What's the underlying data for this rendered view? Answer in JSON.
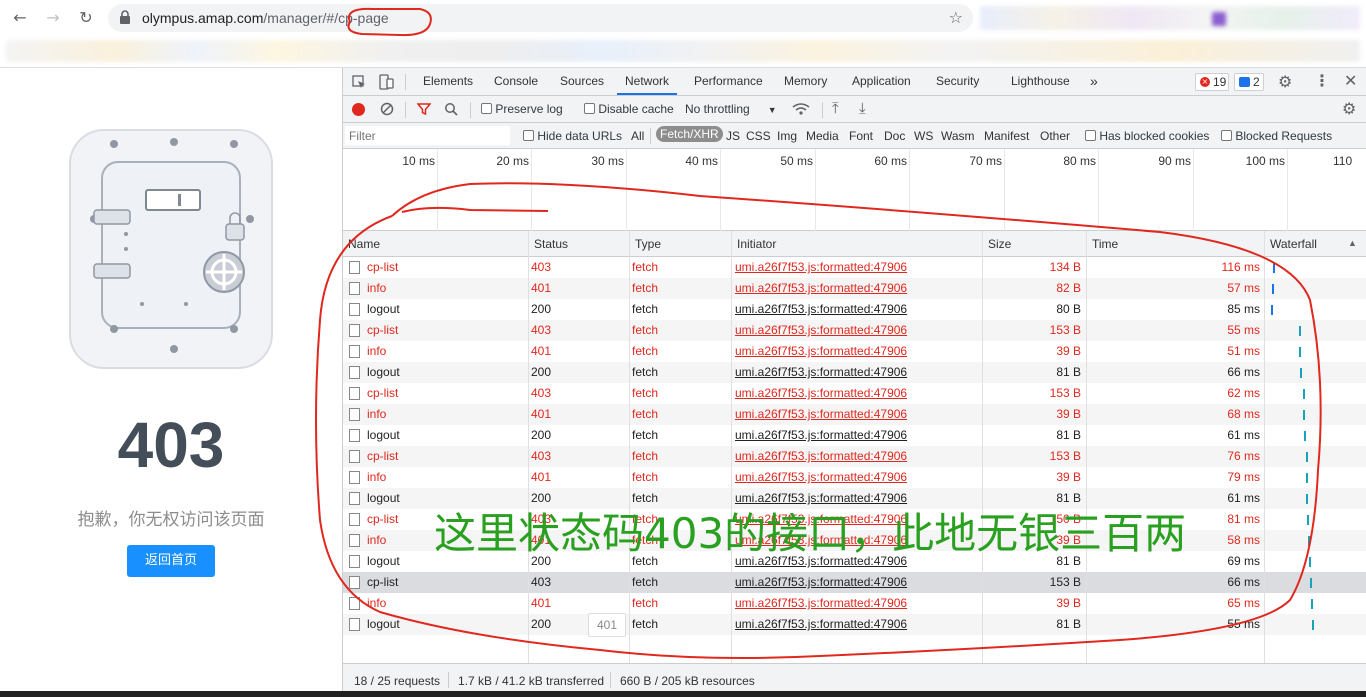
{
  "browser": {
    "url_host": "olympus.amap.com",
    "url_path": "/manager/#/cp-page"
  },
  "page": {
    "error_code": "403",
    "message": "抱歉，你无权访问该页面",
    "back_button": "返回首页"
  },
  "devtools": {
    "tabs": [
      "Elements",
      "Console",
      "Sources",
      "Network",
      "Performance",
      "Memory",
      "Application",
      "Security",
      "Lighthouse"
    ],
    "active_tab": "Network",
    "more_tabs": "»",
    "error_count": "19",
    "message_count": "2",
    "toolbar": {
      "preserve_log": "Preserve log",
      "disable_cache": "Disable cache",
      "throttling": "No throttling"
    },
    "filter": {
      "placeholder": "Filter",
      "hide_data_urls": "Hide data URLs",
      "types": [
        "All",
        "Fetch/XHR",
        "JS",
        "CSS",
        "Img",
        "Media",
        "Font",
        "Doc",
        "WS",
        "Wasm",
        "Manifest",
        "Other"
      ],
      "selected_type": "Fetch/XHR",
      "blocked_cookies": "Has blocked cookies",
      "blocked_requests": "Blocked Requests"
    },
    "timeline_ticks": [
      "10 ms",
      "20 ms",
      "30 ms",
      "40 ms",
      "50 ms",
      "60 ms",
      "70 ms",
      "80 ms",
      "90 ms",
      "100 ms",
      "110"
    ],
    "columns": [
      "Name",
      "Status",
      "Type",
      "Initiator",
      "Size",
      "Time",
      "Waterfall"
    ],
    "rows": [
      {
        "name": "cp-list",
        "status": "403",
        "type": "fetch",
        "initiator": "umi.a26f7f53.js:formatted:47906",
        "size": "134 B",
        "time": "116 ms",
        "error": true
      },
      {
        "name": "info",
        "status": "401",
        "type": "fetch",
        "initiator": "umi.a26f7f53.js:formatted:47906",
        "size": "82 B",
        "time": "57 ms",
        "error": true
      },
      {
        "name": "logout",
        "status": "200",
        "type": "fetch",
        "initiator": "umi.a26f7f53.js:formatted:47906",
        "size": "80 B",
        "time": "85 ms",
        "error": false
      },
      {
        "name": "cp-list",
        "status": "403",
        "type": "fetch",
        "initiator": "umi.a26f7f53.js:formatted:47906",
        "size": "153 B",
        "time": "55 ms",
        "error": true
      },
      {
        "name": "info",
        "status": "401",
        "type": "fetch",
        "initiator": "umi.a26f7f53.js:formatted:47906",
        "size": "39 B",
        "time": "51 ms",
        "error": true
      },
      {
        "name": "logout",
        "status": "200",
        "type": "fetch",
        "initiator": "umi.a26f7f53.js:formatted:47906",
        "size": "81 B",
        "time": "66 ms",
        "error": false
      },
      {
        "name": "cp-list",
        "status": "403",
        "type": "fetch",
        "initiator": "umi.a26f7f53.js:formatted:47906",
        "size": "153 B",
        "time": "62 ms",
        "error": true
      },
      {
        "name": "info",
        "status": "401",
        "type": "fetch",
        "initiator": "umi.a26f7f53.js:formatted:47906",
        "size": "39 B",
        "time": "68 ms",
        "error": true
      },
      {
        "name": "logout",
        "status": "200",
        "type": "fetch",
        "initiator": "umi.a26f7f53.js:formatted:47906",
        "size": "81 B",
        "time": "61 ms",
        "error": false
      },
      {
        "name": "cp-list",
        "status": "403",
        "type": "fetch",
        "initiator": "umi.a26f7f53.js:formatted:47906",
        "size": "153 B",
        "time": "76 ms",
        "error": true
      },
      {
        "name": "info",
        "status": "401",
        "type": "fetch",
        "initiator": "umi.a26f7f53.js:formatted:47906",
        "size": "39 B",
        "time": "79 ms",
        "error": true
      },
      {
        "name": "logout",
        "status": "200",
        "type": "fetch",
        "initiator": "umi.a26f7f53.js:formatted:47906",
        "size": "81 B",
        "time": "61 ms",
        "error": false
      },
      {
        "name": "cp-list",
        "status": "403",
        "type": "fetch",
        "initiator": "umi.a26f7f53.js:formatted:47906",
        "size": "150 B",
        "time": "81 ms",
        "error": true
      },
      {
        "name": "info",
        "status": "401",
        "type": "fetch",
        "initiator": "umi.a26f7f53.js:formatted:47906",
        "size": "39 B",
        "time": "58 ms",
        "error": true
      },
      {
        "name": "logout",
        "status": "200",
        "type": "fetch",
        "initiator": "umi.a26f7f53.js:formatted:47906",
        "size": "81 B",
        "time": "69 ms",
        "error": false
      },
      {
        "name": "cp-list",
        "status": "403",
        "type": "fetch",
        "initiator": "umi.a26f7f53.js:formatted:47906",
        "size": "153 B",
        "time": "66 ms",
        "error": false,
        "selected": true
      },
      {
        "name": "info",
        "status": "401",
        "type": "fetch",
        "initiator": "umi.a26f7f53.js:formatted:47906",
        "size": "39 B",
        "time": "65 ms",
        "error": true
      },
      {
        "name": "logout",
        "status": "200",
        "type": "fetch",
        "initiator": "umi.a26f7f53.js:formatted:47906",
        "size": "81 B",
        "time": "55 ms",
        "error": false
      }
    ],
    "status_bar": {
      "requests": "18 / 25 requests",
      "transferred": "1.7 kB / 41.2 kB transferred",
      "resources": "660 B / 205 kB resources"
    },
    "hover_tooltip": "401"
  },
  "annotation": {
    "text": "这里状态码403的接口，此地无银三百两",
    "color": "#2aa020",
    "ink_color": "#e0281e"
  },
  "colors": {
    "error_text": "#e0281e",
    "accent": "#1a73e8",
    "back_button": "#1890ff"
  }
}
